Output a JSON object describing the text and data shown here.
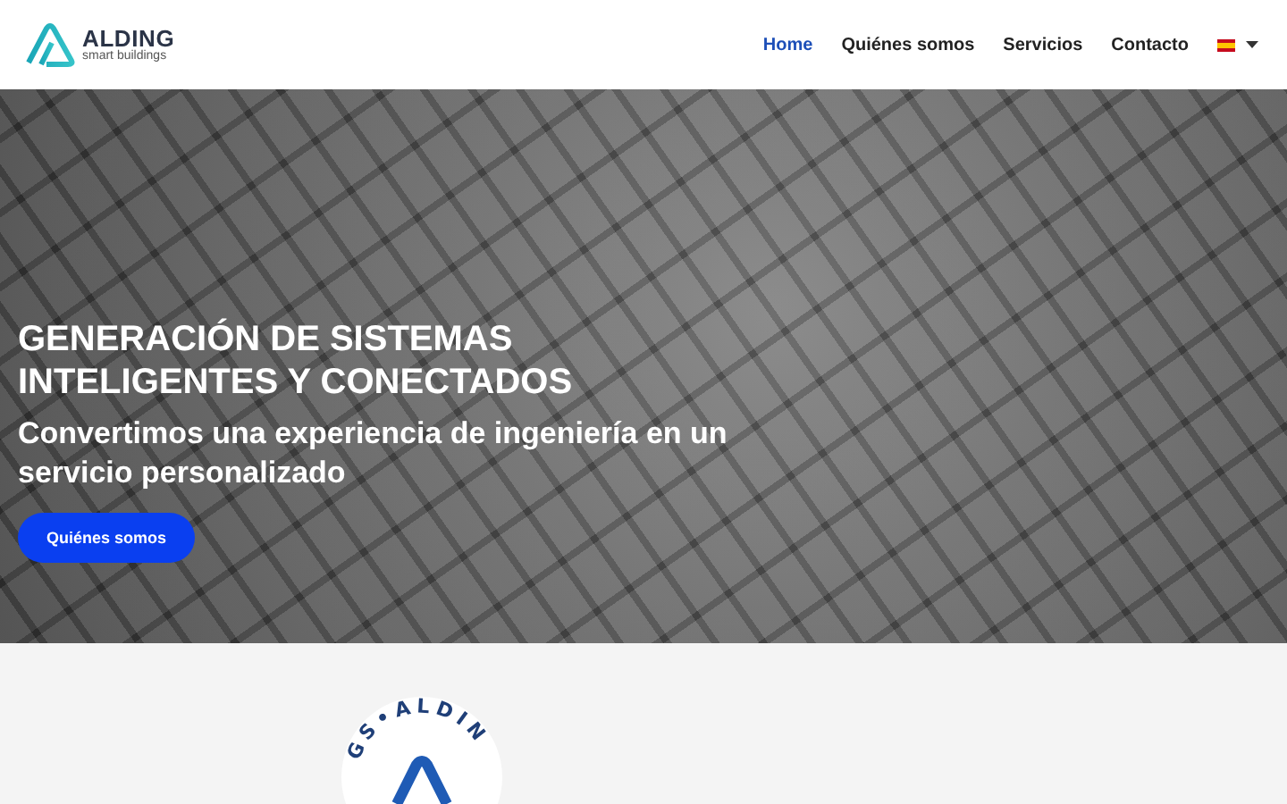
{
  "header": {
    "logo": {
      "name": "ALDING",
      "tagline": "smart buildings"
    },
    "nav": [
      {
        "label": "Home",
        "selected": true
      },
      {
        "label": "Quiénes somos",
        "selected": false
      },
      {
        "label": "Servicios",
        "selected": false
      },
      {
        "label": "Contacto",
        "selected": false
      }
    ]
  },
  "hero": {
    "title": "GENERACIÓN DE SISTEMAS INTELIGENTES Y CONECTADOS",
    "subtitle": "Convertimos una experiencia de ingeniería en un servicio personalizado",
    "button": "Quiénes somos"
  },
  "badge": {
    "text": "GS•ALDIN"
  }
}
